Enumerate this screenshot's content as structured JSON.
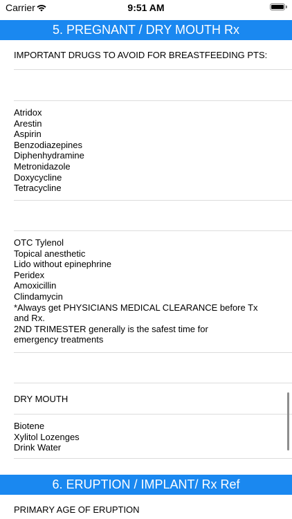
{
  "status_bar": {
    "carrier": "Carrier",
    "time": "9:51 AM"
  },
  "sections": [
    {
      "title": "5. PREGNANT / DRY MOUTH Rx"
    },
    {
      "title": "6. ERUPTION / IMPLANT/ Rx Ref"
    }
  ],
  "rows": {
    "avoid_header": "IMPORTANT DRUGS TO AVOID FOR BREASTFEEDING PTS:",
    "avoid_list": [
      "Atridox",
      "Arestin",
      "Aspirin",
      "Benzodiazepines",
      "Diphenhydramine",
      "Metronidazole",
      "Doxycycline",
      "Tetracycline"
    ],
    "safe_list": [
      "OTC Tylenol",
      "Topical anesthetic",
      "Lido without epinephrine",
      "Peridex",
      "Amoxicillin",
      "Clindamycin",
      "*Always get PHYSICIANS MEDICAL CLEARANCE before Tx",
      "and Rx.",
      "2ND TRIMESTER generally is the safest time for",
      "emergency treatments"
    ],
    "dry_mouth_header": "DRY MOUTH",
    "dry_mouth_list": [
      "Biotene",
      "Xylitol Lozenges",
      "Drink Water"
    ],
    "eruption_header": "PRIMARY AGE OF ERUPTION"
  },
  "colors": {
    "section_header_bg": "#1a88f0",
    "separator": "#dcdcdc"
  }
}
